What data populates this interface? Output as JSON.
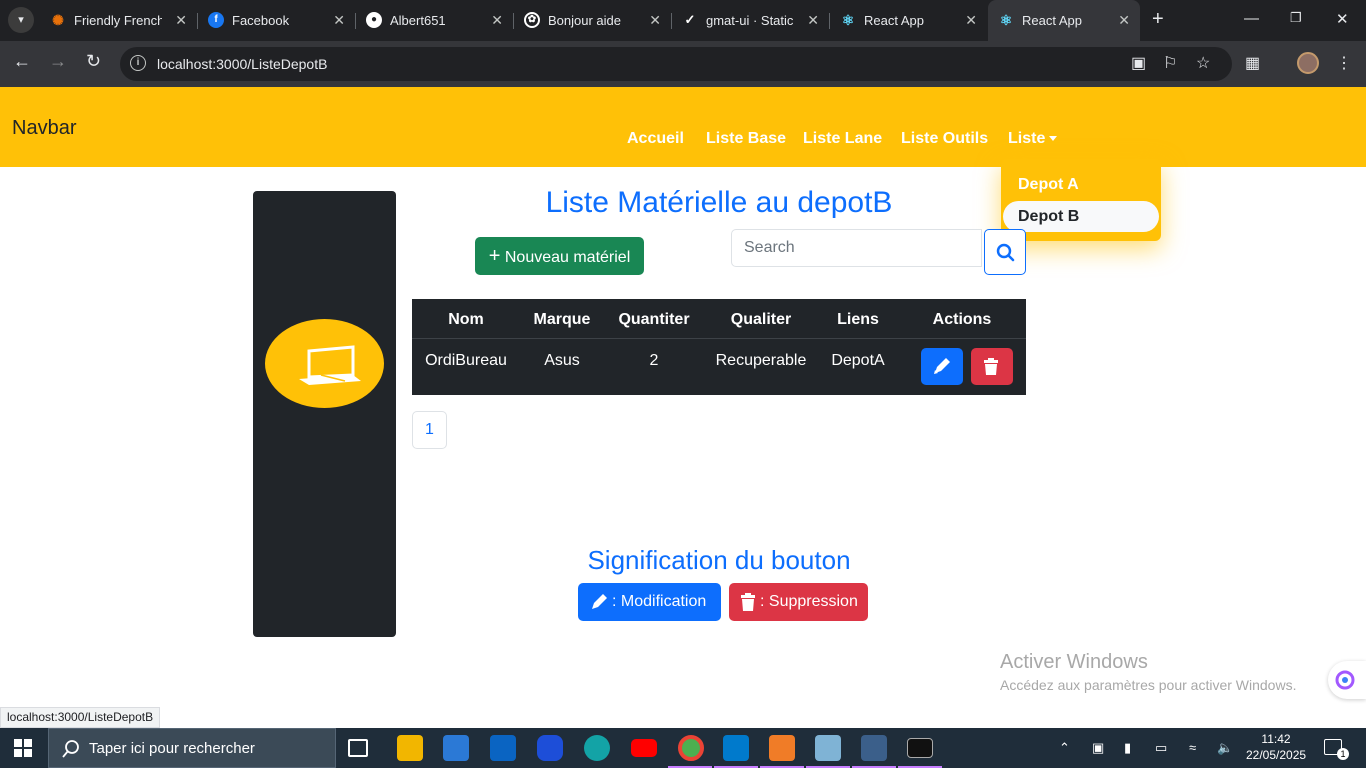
{
  "browser": {
    "tabs": [
      {
        "title": "Friendly French C",
        "icon": "asterisk-icon",
        "color": "#e8710a"
      },
      {
        "title": "Facebook",
        "icon": "facebook-icon",
        "color": "#1877f2"
      },
      {
        "title": "Albert651",
        "icon": "github-icon",
        "color": "#ffffff"
      },
      {
        "title": "Bonjour aide",
        "icon": "openai-icon",
        "color": "#ffffff"
      },
      {
        "title": "gmat-ui · Static",
        "icon": "deploy-icon",
        "color": "#ffffff"
      },
      {
        "title": "React App",
        "icon": "react-icon",
        "color": "#61dafb"
      },
      {
        "title": "React App",
        "icon": "react-icon",
        "color": "#61dafb"
      }
    ],
    "url": "localhost:3000/ListeDepotB",
    "status_url": "localhost:3000/ListeDepotB"
  },
  "navbar": {
    "brand": "Navbar",
    "links": [
      "Accueil",
      "Liste Base",
      "Liste Lane",
      "Liste Outils"
    ],
    "dropdown_label": "Liste",
    "dropdown_items": [
      "Depot A",
      "Depot B"
    ],
    "active_item": "Depot B",
    "color": "#ffc107"
  },
  "main": {
    "title": "Liste Matérielle au depotB",
    "new_button": "Nouveau matériel",
    "search_placeholder": "Search",
    "table": {
      "headers": [
        "Nom",
        "Marque",
        "Quantiter",
        "Qualiter",
        "Liens",
        "Actions"
      ],
      "rows": [
        {
          "nom": "OrdiBureau",
          "marque": "Asus",
          "quantiter": "2",
          "qualiter": "Recuperable",
          "liens": "DepotA"
        }
      ]
    },
    "pagination": [
      "1"
    ],
    "legend_title": "Signification du bouton",
    "legend_edit": ": Modification",
    "legend_delete": ": Suppression"
  },
  "watermark": {
    "title": "Activer Windows",
    "subtitle": "Accédez aux paramètres pour activer Windows."
  },
  "taskbar": {
    "search": "Taper ici pour rechercher",
    "time": "11:42",
    "date": "22/05/2025",
    "notification_count": "1"
  }
}
